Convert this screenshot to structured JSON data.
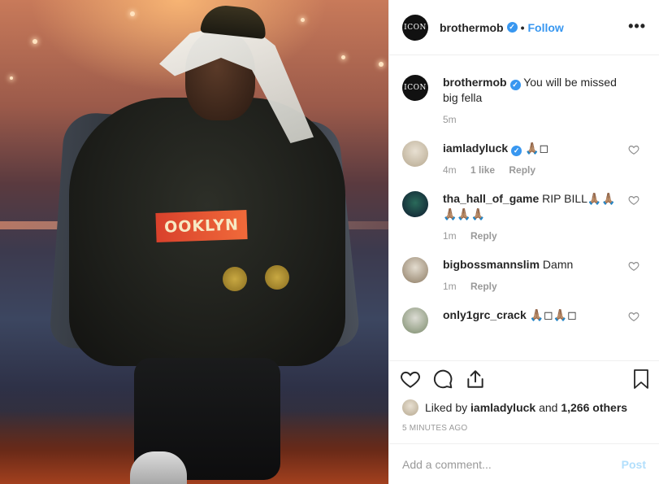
{
  "post": {
    "author": "brothermob",
    "follow_label": "Follow",
    "dot": "•",
    "more": "•••",
    "photo_shirt_text": "OOKLYN",
    "avatar_text": "ICON"
  },
  "caption": {
    "user": "brothermob",
    "text": "You will be missed big fella",
    "time": "5m"
  },
  "comments": [
    {
      "user": "iamladyluck",
      "verified": true,
      "text": "🙏🏽◻",
      "time": "4m",
      "likes": "1 like",
      "reply": "Reply"
    },
    {
      "user": "tha_hall_of_game",
      "verified": false,
      "text": "RIP BILL🙏🏽🙏🏽🙏🏽🙏🏽🙏🏽",
      "time": "1m",
      "likes": "",
      "reply": "Reply"
    },
    {
      "user": "bigbossmannslim",
      "verified": false,
      "text": "Damn",
      "time": "1m",
      "likes": "",
      "reply": "Reply"
    },
    {
      "user": "only1grc_crack",
      "verified": false,
      "text": "🙏🏽◻🙏🏽◻",
      "time": "",
      "likes": "",
      "reply": ""
    }
  ],
  "likes": {
    "prefix": "Liked by",
    "user": "iamladyluck",
    "and": "and",
    "count": "1,266 others"
  },
  "timestamp": "5 MINUTES AGO",
  "add_comment": {
    "placeholder": "Add a comment...",
    "post_label": "Post"
  },
  "colors": {
    "accent": "#3897f0",
    "post_disabled": "#b2dffc",
    "muted": "#999999"
  }
}
